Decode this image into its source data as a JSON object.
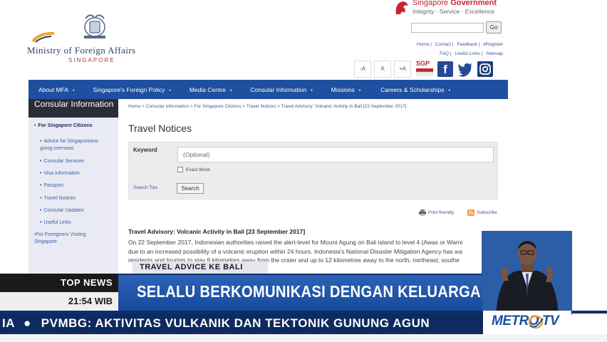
{
  "header": {
    "mfa_title": "Ministry of Foreign Affairs",
    "mfa_subtitle": "SINGAPORE",
    "gov_title_1": "Singapore",
    "gov_title_2": "Government",
    "gov_tagline": "Integrity · Service · Excellence",
    "go_label": "Go",
    "util_links_row1": [
      "Home",
      "Contact",
      "Feedback",
      "eRegister"
    ],
    "util_links_row2": [
      "FAQ",
      "Useful Links",
      "Sitemap"
    ],
    "font_sizes": [
      "-A",
      "A",
      "+A"
    ],
    "sgp_label": "SGP"
  },
  "nav": {
    "items": [
      "About MFA",
      "Singapore's Foreign Policy",
      "Media Centre",
      "Consular Information",
      "Missions",
      "Careers & Scholarships"
    ]
  },
  "sidebar": {
    "heading": "Consular Information",
    "main": "For Singapore Citizens",
    "items": [
      "Advice for Singaporeans going overseas",
      "Consular Services",
      "Visa Information",
      "Passport",
      "Travel Notices",
      "Consular Updates",
      "Useful Links"
    ],
    "bottom": "For Foreigners Visiting Singapore"
  },
  "main": {
    "breadcrumb": "Home  >  Consular Information  >  For Singapore Citizens  >  Travel Notices  >  Travel Advisory: Volcanic Activity in Bali [23 September 2017]",
    "title": "Travel Notices",
    "keyword_label": "Keyword",
    "keyword_placeholder": "(Optional)",
    "exact_word": "Exact Word",
    "search_tips": "Search Tips",
    "search_button": "Search",
    "print_friendly": "Print friendly",
    "subscribe": "Subscribe",
    "advisory_title": "Travel Advisory: Volcanic Activity in Bali [23 September 2017]",
    "advisory_line1": "On 22 September 2017, Indonesian authorities raised the alert-level for Mount Agung on Bali island to level 4 (Awas or Warni",
    "advisory_line2": "due to an increased possibility of a volcanic eruption within 24 hours. Indonesia's National Disaster Mitigation Agency has wa",
    "advisory_line3": "residents and tourists to stay 9 kilometres away from the crater and up to 12 kilometres away to the north, northeast, southe"
  },
  "broadcast": {
    "tag": "TRAVEL ADVICE KE BALI",
    "top_news": "TOP NEWS",
    "time": "21:54 WIB",
    "headline": "SELALU BERKOMUNIKASI DENGAN KELUARGA",
    "ticker_prefix": "IA",
    "ticker": "PVMBG: AKTIVITAS VULKANIK DAN TEKTONIK GUNUNG AGUN",
    "channel": "METRO TV"
  },
  "colors": {
    "nav_blue": "#1e4fa0",
    "headline_blue": "#2c62b7",
    "ticker_navy": "#0f2a5f",
    "gov_red": "#c3272e"
  }
}
